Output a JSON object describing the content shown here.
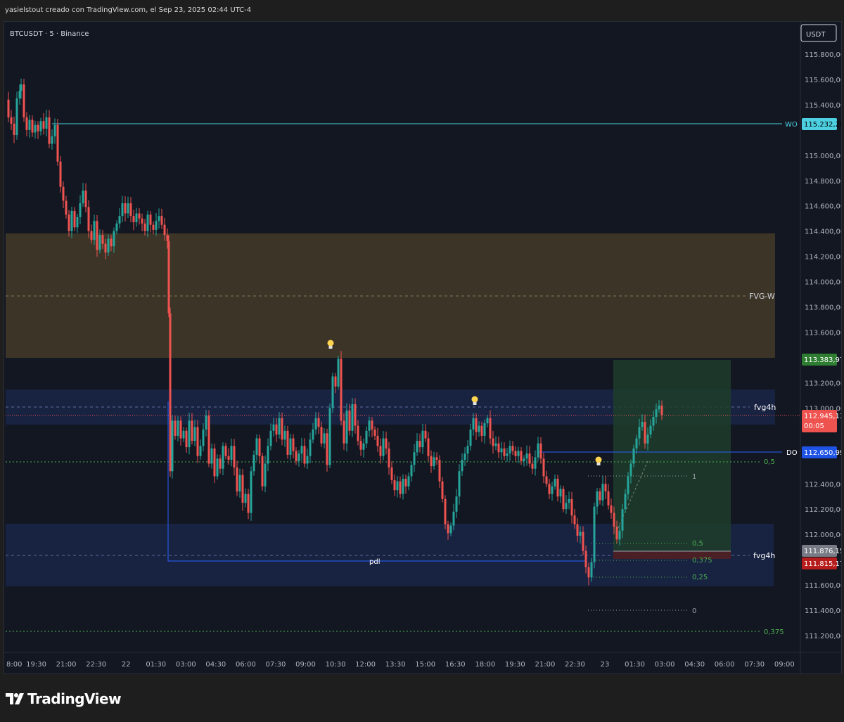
{
  "header": {
    "credit": "yasielstout creado con TradingView.com, el Sep 23, 2025 02:44 UTC-4"
  },
  "chart": {
    "symbol_title": "BTCUSDT · 5 · Binance",
    "currency": "USDT",
    "price_ticks": [
      "115.800,00",
      "115.600,00",
      "115.400,00",
      "115.000,00",
      "114.800,00",
      "114.600,00",
      "114.400,00",
      "114.200,00",
      "114.000,00",
      "113.800,00",
      "113.600,00",
      "113.200,00",
      "113.000,00",
      "112.400,00",
      "112.200,00",
      "112.000,00",
      "111.600,00",
      "111.400,00",
      "111.200,00"
    ],
    "time_ticks": [
      "8:00",
      "19:30",
      "21:00",
      "22:30",
      "22",
      "01:30",
      "03:00",
      "04:30",
      "06:00",
      "07:30",
      "09:00",
      "10:30",
      "12:00",
      "13:30",
      "15:00",
      "16:30",
      "18:00",
      "19:30",
      "21:00",
      "22:30",
      "23",
      "01:30",
      "03:00",
      "04:30",
      "06:00",
      "07:30",
      "09:00"
    ],
    "price_badges": {
      "wo": {
        "value": "115.232,29",
        "color": "#4dd0e1"
      },
      "target": {
        "value": "113.383,97",
        "color": "#2e7d32"
      },
      "last": {
        "value": "112.945,13",
        "countdown": "00:05",
        "color": "#ef5350"
      },
      "do": {
        "value": "112.650,99",
        "color": "#1e53e5"
      },
      "entry": {
        "value": "111.876,15",
        "color": "#787b86"
      },
      "stop": {
        "value": "111.815,17",
        "color": "#b71c1c"
      }
    },
    "labels": {
      "wo": "WO",
      "do": "DO",
      "fvg_w": "FVG-W",
      "fvg4h_top": "fvg4h",
      "fvg4h_bottom": "fvg4h",
      "pdl": "pdl",
      "fib_05_left": "0,5",
      "fib_0375_left": "0,375",
      "fib_1": "1",
      "fib_05": "0,5",
      "fib_0375": "0,375",
      "fib_025": "0,25",
      "fib_0": "0"
    },
    "zones": {
      "fvg_w_color": "#3b3427",
      "fvg4h_color": "#1a2547",
      "position_profit_color": "#1f3d2c",
      "position_loss_color": "#4a1f25"
    },
    "colors": {
      "bull": "#26a69a",
      "bear": "#ef5350",
      "background": "#131722"
    },
    "icons": [
      "lightbulb-icon",
      "lightbulb-icon",
      "lightbulb-icon"
    ]
  },
  "chart_data": {
    "type": "candlestick",
    "ylim": [
      111100,
      115900
    ],
    "ohlc_close_path_points": [
      [
        0,
        115440
      ],
      [
        4,
        115300
      ],
      [
        8,
        115250
      ],
      [
        12,
        115160
      ],
      [
        16,
        115450
      ],
      [
        20,
        115510
      ],
      [
        22,
        115560
      ],
      [
        26,
        115300
      ],
      [
        30,
        115200
      ],
      [
        34,
        115280
      ],
      [
        38,
        115180
      ],
      [
        42,
        115240
      ],
      [
        46,
        115190
      ],
      [
        50,
        115270
      ],
      [
        54,
        115210
      ],
      [
        58,
        115300
      ],
      [
        62,
        115090
      ],
      [
        66,
        115150
      ],
      [
        70,
        115240
      ],
      [
        74,
        114950
      ],
      [
        78,
        114750
      ],
      [
        82,
        114640
      ],
      [
        86,
        114530
      ],
      [
        90,
        114400
      ],
      [
        94,
        114560
      ],
      [
        98,
        114430
      ],
      [
        102,
        114510
      ],
      [
        106,
        114620
      ],
      [
        110,
        114720
      ],
      [
        114,
        114590
      ],
      [
        118,
        114400
      ],
      [
        122,
        114330
      ],
      [
        126,
        114480
      ],
      [
        130,
        114250
      ],
      [
        134,
        114370
      ],
      [
        138,
        114300
      ],
      [
        142,
        114230
      ],
      [
        146,
        114340
      ],
      [
        150,
        114280
      ],
      [
        154,
        114400
      ],
      [
        158,
        114460
      ],
      [
        162,
        114520
      ],
      [
        166,
        114620
      ],
      [
        170,
        114540
      ],
      [
        174,
        114620
      ],
      [
        178,
        114520
      ],
      [
        182,
        114470
      ],
      [
        186,
        114540
      ],
      [
        190,
        114500
      ],
      [
        194,
        114460
      ],
      [
        198,
        114400
      ],
      [
        202,
        114530
      ],
      [
        206,
        114450
      ],
      [
        210,
        114410
      ],
      [
        214,
        114480
      ],
      [
        218,
        114520
      ],
      [
        222,
        114450
      ],
      [
        226,
        114370
      ],
      [
        230,
        114320
      ],
      [
        232,
        113750
      ],
      [
        234,
        112500
      ],
      [
        237,
        112900
      ],
      [
        241,
        112780
      ],
      [
        245,
        112900
      ],
      [
        249,
        112760
      ],
      [
        253,
        112820
      ],
      [
        257,
        112690
      ],
      [
        261,
        112900
      ],
      [
        265,
        112740
      ],
      [
        269,
        112850
      ],
      [
        273,
        112620
      ],
      [
        277,
        112700
      ],
      [
        281,
        112830
      ],
      [
        285,
        112940
      ],
      [
        289,
        112560
      ],
      [
        293,
        112680
      ],
      [
        297,
        112460
      ],
      [
        301,
        112600
      ],
      [
        305,
        112520
      ],
      [
        309,
        112700
      ],
      [
        313,
        112620
      ],
      [
        317,
        112590
      ],
      [
        321,
        112700
      ],
      [
        325,
        112530
      ],
      [
        329,
        112340
      ],
      [
        333,
        112470
      ],
      [
        337,
        112250
      ],
      [
        341,
        112320
      ],
      [
        345,
        112170
      ],
      [
        349,
        112500
      ],
      [
        353,
        112630
      ],
      [
        357,
        112760
      ],
      [
        361,
        112620
      ],
      [
        365,
        112380
      ],
      [
        369,
        112560
      ],
      [
        373,
        112700
      ],
      [
        377,
        112820
      ],
      [
        381,
        112870
      ],
      [
        385,
        112790
      ],
      [
        389,
        112920
      ],
      [
        393,
        112750
      ],
      [
        397,
        112820
      ],
      [
        401,
        112630
      ],
      [
        405,
        112760
      ],
      [
        409,
        112660
      ],
      [
        413,
        112580
      ],
      [
        417,
        112640
      ],
      [
        421,
        112700
      ],
      [
        425,
        112560
      ],
      [
        429,
        112620
      ],
      [
        433,
        112750
      ],
      [
        437,
        112830
      ],
      [
        441,
        112920
      ],
      [
        445,
        112850
      ],
      [
        449,
        112720
      ],
      [
        453,
        112800
      ],
      [
        457,
        112550
      ],
      [
        461,
        113000
      ],
      [
        465,
        113250
      ],
      [
        469,
        113170
      ],
      [
        473,
        113390
      ],
      [
        477,
        112900
      ],
      [
        481,
        112720
      ],
      [
        485,
        112980
      ],
      [
        489,
        112820
      ],
      [
        493,
        113030
      ],
      [
        497,
        112860
      ],
      [
        501,
        112740
      ],
      [
        505,
        112670
      ],
      [
        509,
        112720
      ],
      [
        513,
        112820
      ],
      [
        517,
        112900
      ],
      [
        521,
        112830
      ],
      [
        525,
        112780
      ],
      [
        529,
        112700
      ],
      [
        533,
        112620
      ],
      [
        537,
        112760
      ],
      [
        541,
        112680
      ],
      [
        545,
        112530
      ],
      [
        549,
        112430
      ],
      [
        553,
        112350
      ],
      [
        557,
        112420
      ],
      [
        561,
        112320
      ],
      [
        565,
        112440
      ],
      [
        569,
        112380
      ],
      [
        573,
        112460
      ],
      [
        577,
        112550
      ],
      [
        581,
        112650
      ],
      [
        585,
        112740
      ],
      [
        589,
        112690
      ],
      [
        593,
        112820
      ],
      [
        597,
        112760
      ],
      [
        601,
        112620
      ],
      [
        605,
        112540
      ],
      [
        609,
        112610
      ],
      [
        613,
        112590
      ],
      [
        617,
        112420
      ],
      [
        621,
        112280
      ],
      [
        625,
        112080
      ],
      [
        629,
        112010
      ],
      [
        633,
        112070
      ],
      [
        637,
        112180
      ],
      [
        641,
        112300
      ],
      [
        645,
        112500
      ],
      [
        649,
        112590
      ],
      [
        653,
        112640
      ],
      [
        657,
        112700
      ],
      [
        661,
        112830
      ],
      [
        665,
        112920
      ],
      [
        669,
        112810
      ],
      [
        673,
        112860
      ],
      [
        677,
        112780
      ],
      [
        681,
        112880
      ],
      [
        685,
        112920
      ],
      [
        689,
        112760
      ],
      [
        693,
        112700
      ],
      [
        697,
        112720
      ],
      [
        701,
        112650
      ],
      [
        705,
        112680
      ],
      [
        709,
        112620
      ],
      [
        713,
        112640
      ],
      [
        717,
        112700
      ],
      [
        721,
        112660
      ],
      [
        725,
        112620
      ],
      [
        729,
        112660
      ],
      [
        733,
        112580
      ],
      [
        737,
        112600
      ],
      [
        741,
        112640
      ],
      [
        745,
        112560
      ],
      [
        749,
        112520
      ],
      [
        753,
        112610
      ],
      [
        757,
        112720
      ],
      [
        761,
        112600
      ],
      [
        765,
        112460
      ],
      [
        769,
        112400
      ],
      [
        773,
        112320
      ],
      [
        777,
        112380
      ],
      [
        781,
        112440
      ],
      [
        785,
        112300
      ],
      [
        789,
        112360
      ],
      [
        793,
        112200
      ],
      [
        797,
        112250
      ],
      [
        801,
        112280
      ],
      [
        805,
        112150
      ],
      [
        809,
        112080
      ],
      [
        813,
        111990
      ],
      [
        817,
        112020
      ],
      [
        821,
        111870
      ],
      [
        825,
        111740
      ],
      [
        829,
        111660
      ],
      [
        833,
        111780
      ],
      [
        837,
        112220
      ],
      [
        841,
        112340
      ],
      [
        845,
        112270
      ],
      [
        849,
        112400
      ],
      [
        853,
        112340
      ],
      [
        857,
        112230
      ],
      [
        861,
        112170
      ],
      [
        865,
        112060
      ],
      [
        869,
        111960
      ],
      [
        873,
        112030
      ],
      [
        877,
        112200
      ],
      [
        881,
        112320
      ],
      [
        885,
        112460
      ],
      [
        889,
        112560
      ],
      [
        893,
        112680
      ],
      [
        897,
        112760
      ],
      [
        901,
        112850
      ],
      [
        905,
        112890
      ],
      [
        909,
        112720
      ],
      [
        913,
        112790
      ],
      [
        917,
        112860
      ],
      [
        921,
        112930
      ],
      [
        925,
        112990
      ],
      [
        929,
        113020
      ],
      [
        933,
        112945
      ]
    ],
    "series_note": ""
  }
}
